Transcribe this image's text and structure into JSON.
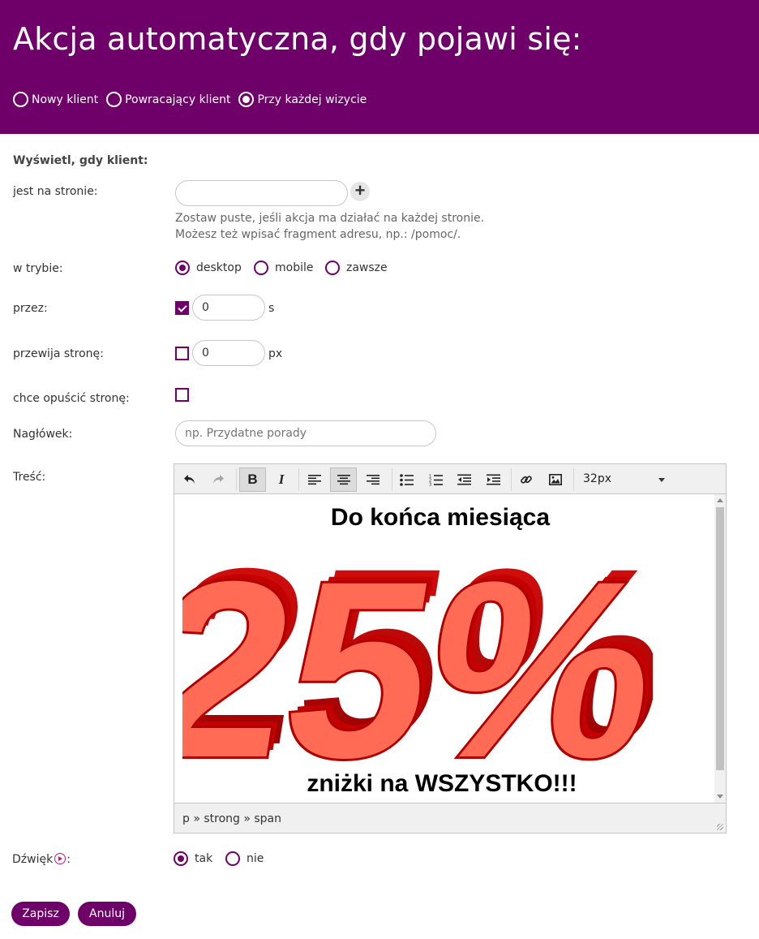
{
  "header": {
    "title": "Akcja automatyczna, gdy pojawi się:",
    "options": [
      {
        "label": "Nowy klient",
        "selected": false
      },
      {
        "label": "Powracający klient",
        "selected": false
      },
      {
        "label": "Przy każdej wizycie",
        "selected": true
      }
    ]
  },
  "form": {
    "section_title": "Wyświetl, gdy klient:",
    "page_label": "jest na stronie:",
    "page_value": "",
    "hint_line1": "Zostaw puste, jeśli akcja ma działać na każdej stronie.",
    "hint_line2": "Możesz też wpisać fragment adresu, np.: /pomoc/.",
    "mode_label": "w trybie:",
    "mode_options": [
      {
        "label": "desktop",
        "selected": true
      },
      {
        "label": "mobile",
        "selected": false
      },
      {
        "label": "zawsze",
        "selected": false
      }
    ],
    "time_label": "przez:",
    "time_checked": true,
    "time_value": "0",
    "time_unit": "s",
    "scroll_label": "przewija stronę:",
    "scroll_checked": false,
    "scroll_value": "0",
    "scroll_unit": "px",
    "exit_label": "chce opuścić stronę:",
    "exit_checked": false,
    "heading_label": "Nagłówek:",
    "heading_placeholder": "np. Przydatne porady",
    "content_label": "Treść:"
  },
  "editor": {
    "font_size": "32px",
    "content_title": "Do końca miesiąca",
    "promo_text": "25%",
    "content_subtitle": "zniżki na WSZYSTKO!!!",
    "path": "p » strong » span",
    "colors": {
      "promo_fill": "#ff6b55",
      "promo_side": "#c40000"
    }
  },
  "sound": {
    "label_prefix": "Dźwięk",
    "label_suffix": ":",
    "options": [
      {
        "label": "tak",
        "selected": true
      },
      {
        "label": "nie",
        "selected": false
      }
    ]
  },
  "buttons": {
    "save": "Zapisz",
    "cancel": "Anuluj"
  },
  "colors": {
    "brand": "#6f006a",
    "accent": "#c2187c"
  }
}
